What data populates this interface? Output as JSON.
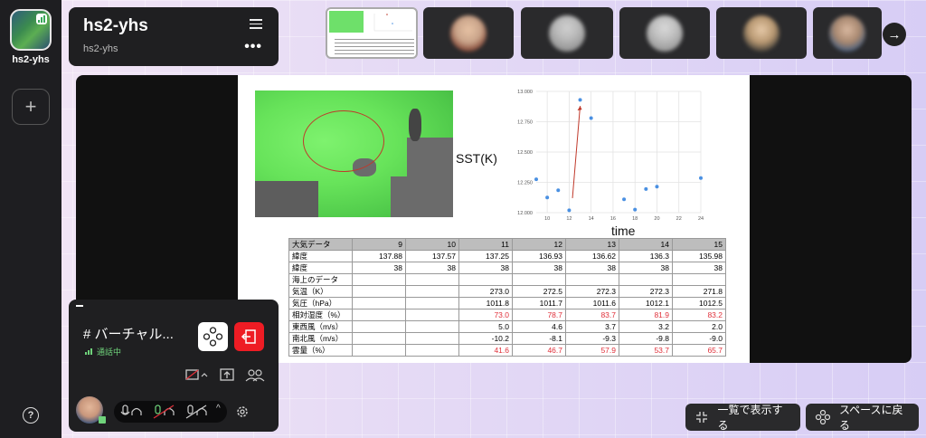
{
  "sidebar": {
    "space_name": "hs2-yhs",
    "add_label": "+",
    "help_label": "?"
  },
  "space_card": {
    "title": "hs2-yhs",
    "subtitle": "hs2-yhs",
    "more": "•••"
  },
  "strip": {
    "next_label": "→"
  },
  "slide": {
    "sst_label": "SST(K)",
    "time_label": "time",
    "chart_data": {
      "type": "scatter",
      "x": [
        9,
        10,
        11,
        12,
        13,
        14,
        17,
        18,
        19,
        20,
        24
      ],
      "y": [
        12.275,
        12.125,
        12.185,
        12.02,
        12.93,
        12.78,
        12.11,
        12.025,
        12.195,
        12.215,
        12.285
      ],
      "xticks": [
        "10",
        "12",
        "14",
        "16",
        "18",
        "20",
        "22",
        "24"
      ],
      "yticks": [
        "12.000",
        "12.250",
        "12.500",
        "12.750",
        "13.000"
      ],
      "xlim": [
        9,
        24
      ],
      "ylim": [
        12.0,
        13.0
      ],
      "grid": true,
      "color": "#4a90e2",
      "annotation_color": "#c0392b"
    },
    "table": {
      "header": [
        "大気データ",
        "9",
        "10",
        "11",
        "12",
        "13",
        "14",
        "15"
      ],
      "rows": [
        [
          "緯度",
          "137.88",
          "137.57",
          "137.25",
          "136.93",
          "136.62",
          "136.3",
          "135.98"
        ],
        [
          "緯度",
          "38",
          "38",
          "38",
          "38",
          "38",
          "38",
          "38"
        ],
        [
          "海上のデータ",
          "",
          "",
          "",
          "",
          "",
          "",
          ""
        ],
        [
          "気温（K）",
          "",
          "",
          "273.0",
          "272.5",
          "272.3",
          "272.3",
          "271.8"
        ],
        [
          "気圧（hPa）",
          "",
          "",
          "1011.8",
          "1011.7",
          "1011.6",
          "1012.1",
          "1012.5"
        ],
        [
          "相対湿度（%）",
          "",
          "",
          "73.0",
          "78.7",
          "83.7",
          "81.9",
          "83.2"
        ],
        [
          "東西風（m/s）",
          "",
          "",
          "5.0",
          "4.6",
          "3.7",
          "3.2",
          "2.0"
        ],
        [
          "南北風（m/s）",
          "",
          "",
          "-10.2",
          "-8.1",
          "-9.3",
          "-9.8",
          "-9.0"
        ],
        [
          "雲量（%）",
          "",
          "",
          "41.6",
          "46.7",
          "57.9",
          "53.7",
          "65.7"
        ]
      ],
      "red_rows": [
        5,
        8
      ]
    }
  },
  "call": {
    "title": "# バーチャル...",
    "status": "通話中"
  },
  "buttons": {
    "list_view": "一覧で表示する",
    "back_to_space": "スペースに戻る"
  },
  "colors": {
    "leave": "#ee1c24",
    "status_green": "#6fd37b"
  }
}
